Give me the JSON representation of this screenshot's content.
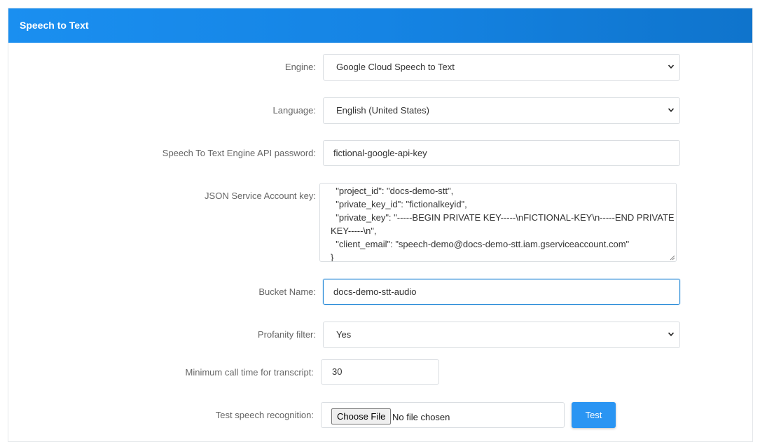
{
  "panel": {
    "title": "Speech to Text"
  },
  "form": {
    "engine": {
      "label": "Engine:",
      "value": "Google Cloud Speech to Text"
    },
    "language": {
      "label": "Language:",
      "value": "English (United States)"
    },
    "api_password": {
      "label": "Speech To Text Engine API password:",
      "value": "fictional-google-api-key"
    },
    "json_key": {
      "label": "JSON Service Account key:",
      "lines": [
        "  \"project_id\": \"docs-demo-stt\",",
        "  \"private_key_id\": \"fictionalkeyid\",",
        "  \"private_key\": \"-----BEGIN PRIVATE KEY-----\\nFICTIONAL-KEY\\n-----END PRIVATE",
        "KEY-----\\n\",",
        "  \"client_email\": \"speech-demo@docs-demo-stt.iam.gserviceaccount.com\"",
        "}"
      ]
    },
    "bucket_name": {
      "label": "Bucket Name:",
      "value": "docs-demo-stt-audio"
    },
    "profanity_filter": {
      "label": "Profanity filter:",
      "value": "Yes"
    },
    "min_call_time": {
      "label": "Minimum call time for transcript:",
      "value": "30"
    },
    "test_speech": {
      "label": "Test speech recognition:",
      "choose_file_label": "Choose File",
      "file_status": "No file chosen",
      "test_button_label": "Test"
    }
  },
  "colors": {
    "header_start": "#1a8ff0",
    "header_end": "#0f74cc",
    "primary_button": "#2a95f3",
    "focus_border": "#1f86d6"
  },
  "icons": {
    "dropdown": "chevron-down-icon",
    "resize": "resize-grip-icon"
  }
}
